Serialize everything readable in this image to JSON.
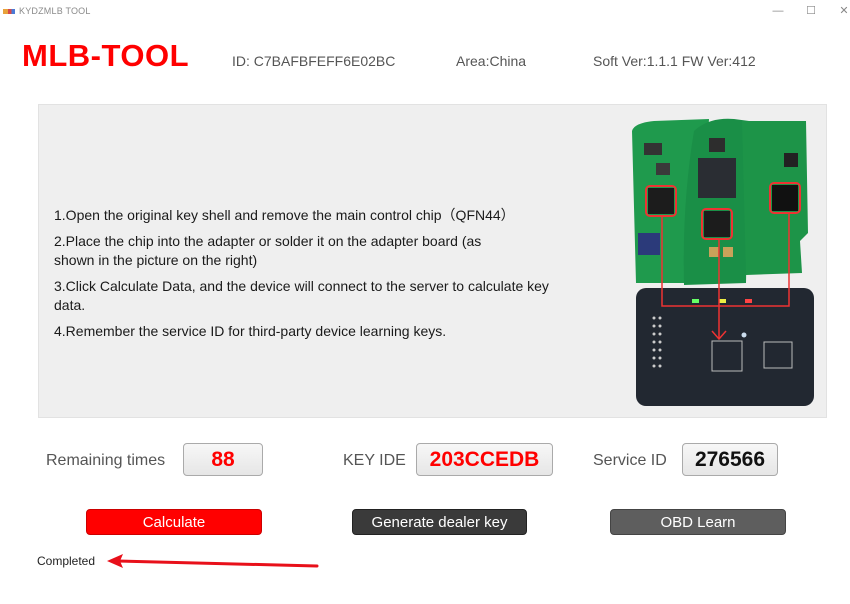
{
  "window": {
    "title": "KYDZMLB TOOL",
    "controls": [
      "minimize",
      "maximize",
      "close"
    ],
    "minimize_glyph": "—",
    "maximize_glyph": "☐",
    "close_glyph": "✕"
  },
  "header": {
    "logo": "MLB-TOOL",
    "device_id": "ID: C7BAFBFEFF6E02BC",
    "area": "Area:China",
    "version": "Soft Ver:1.1.1  FW Ver:412"
  },
  "instructions": {
    "steps": [
      "1.Open the original key shell and remove the main control chip（QFN44）",
      "2.Place the chip into the adapter or solder it on the adapter board (as shown in the picture on the right)",
      "3.Click Calculate Data, and the device will connect to the server to calculate key data.",
      "4.Remember the service ID for third-party device learning keys."
    ],
    "image": "key-pcb-adapter-diagram"
  },
  "fields": {
    "remaining": {
      "label": "Remaining times",
      "value": "88"
    },
    "key_ide": {
      "label": "KEY IDE",
      "value": "203CCEDB"
    },
    "service_id": {
      "label": "Service ID",
      "value": "276566"
    }
  },
  "buttons": {
    "calculate": "Calculate",
    "dealer_key": "Generate dealer key",
    "obd_learn": "OBD Learn"
  },
  "status": {
    "text": "Completed"
  },
  "colors": {
    "brand": "#ff0000",
    "calculate_bg": "#ff0000",
    "dealer_bg": "#3a3a3a",
    "obd_bg": "#5e5e5e",
    "panel_bg": "#efefef"
  }
}
